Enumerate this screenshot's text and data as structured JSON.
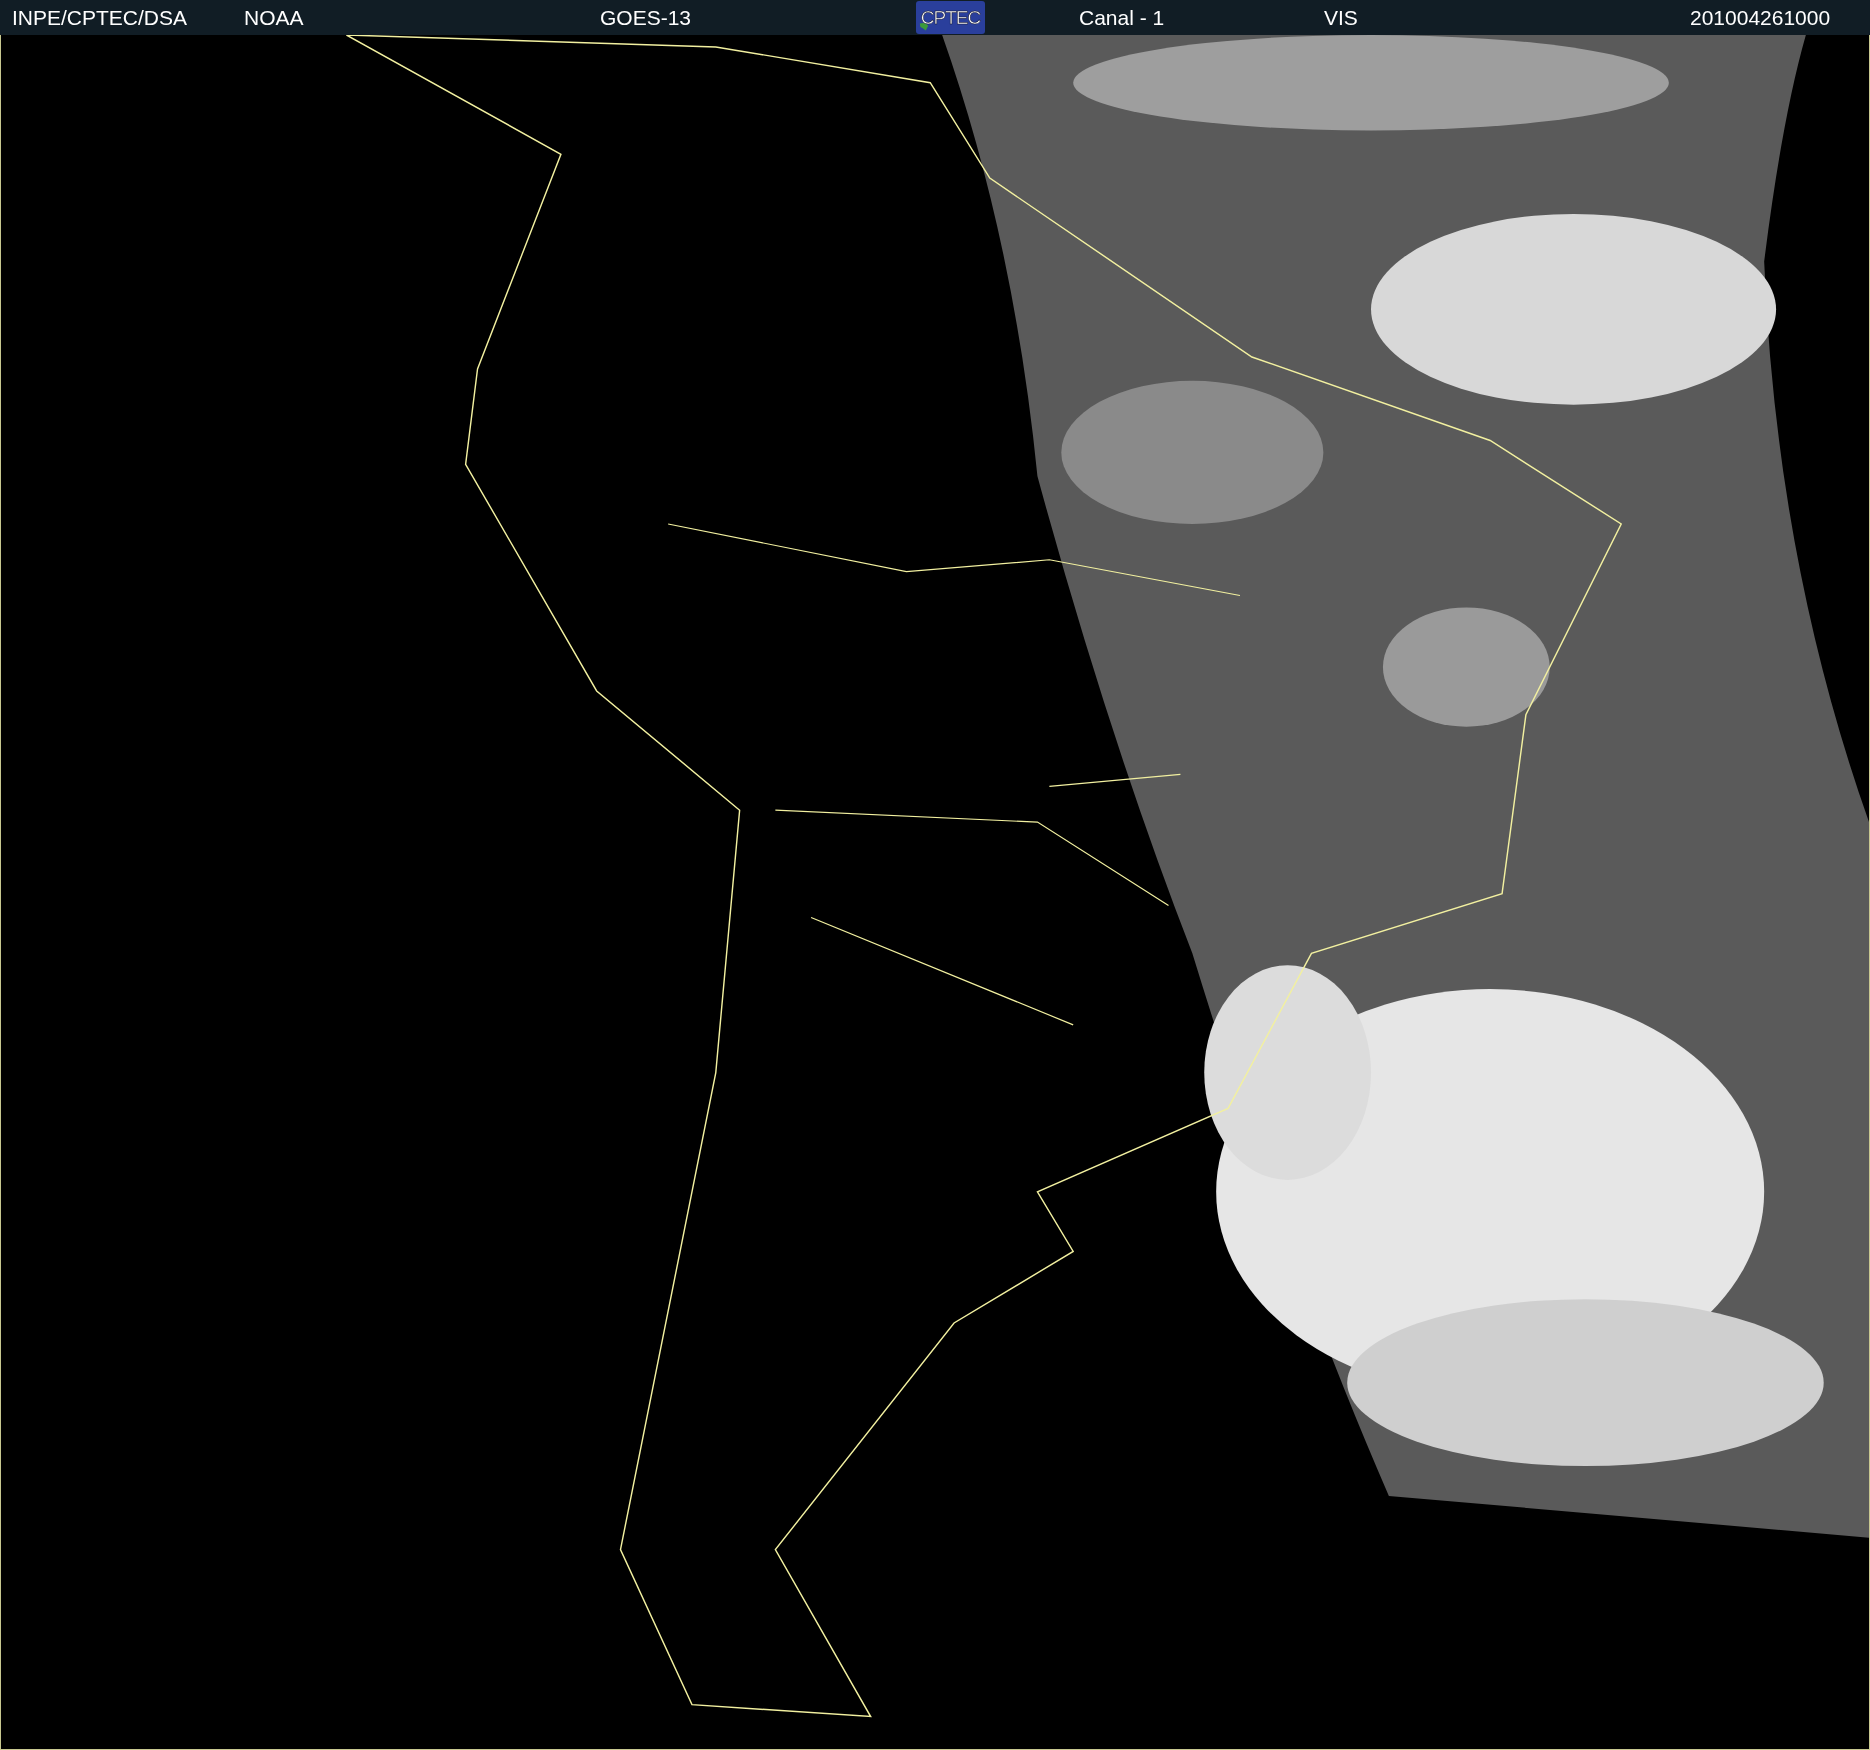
{
  "header": {
    "agency": "INPE/CPTEC/DSA",
    "source": "NOAA",
    "satellite": "GOES-13",
    "logo": "CPTEC",
    "channel": "Canal - 1",
    "band": "VIS",
    "timestamp": "201004261000"
  }
}
